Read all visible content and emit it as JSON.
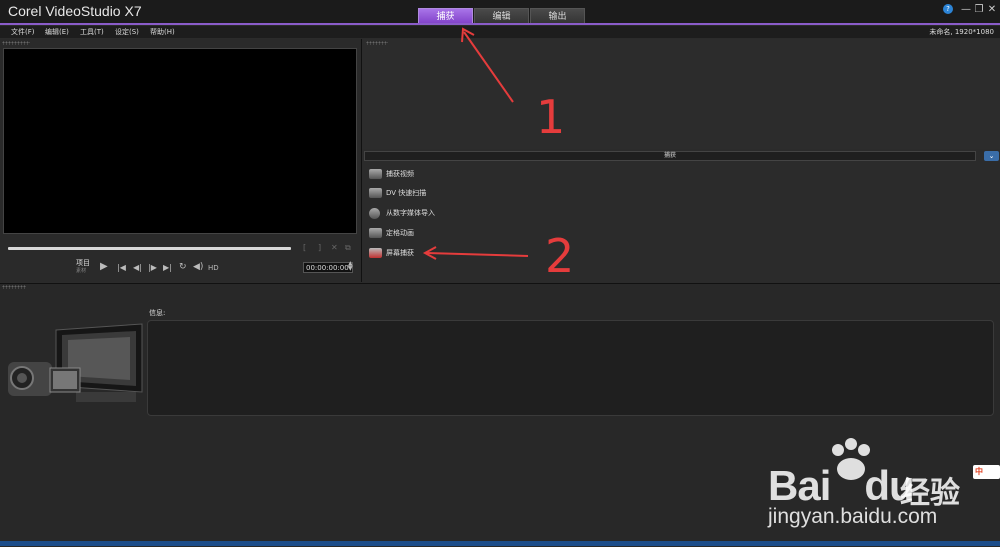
{
  "app": {
    "title": "Corel VideoStudio X7"
  },
  "tabs": [
    {
      "label": "捕获",
      "active": true
    },
    {
      "label": "编辑",
      "active": false
    },
    {
      "label": "输出",
      "active": false
    }
  ],
  "window_controls": [
    "?",
    "—",
    "❐",
    "✕"
  ],
  "menu": [
    "文件(F)",
    "编辑(E)",
    "工具(T)",
    "设定(S)",
    "帮助(H)"
  ],
  "project_info": "未命名, 1920*1080",
  "player": {
    "mode_label": "项目",
    "mode_sub": "素材",
    "hd_label": "HD",
    "timecode": "00:00:00:00"
  },
  "capture": {
    "header": "捕获",
    "items": [
      {
        "label": "捕获视频",
        "icon": "camera-icon"
      },
      {
        "label": "DV 快速扫描",
        "icon": "dv-scan-icon"
      },
      {
        "label": "从数字媒体导入",
        "icon": "disc-icon"
      },
      {
        "label": "定格动画",
        "icon": "stop-motion-icon"
      },
      {
        "label": "屏幕捕获",
        "icon": "screen-capture-icon"
      }
    ]
  },
  "info": {
    "label": "信息:"
  },
  "annotations": [
    "1",
    "2"
  ],
  "watermark": {
    "brand": "Bai",
    "brand_du": "du",
    "brand_cn": "经验",
    "url": "jingyan.baidu.com",
    "ime": "中"
  },
  "colors": {
    "accent": "#8a5cc9",
    "annotation": "#e53c3c",
    "collapse": "#3a6da8"
  }
}
